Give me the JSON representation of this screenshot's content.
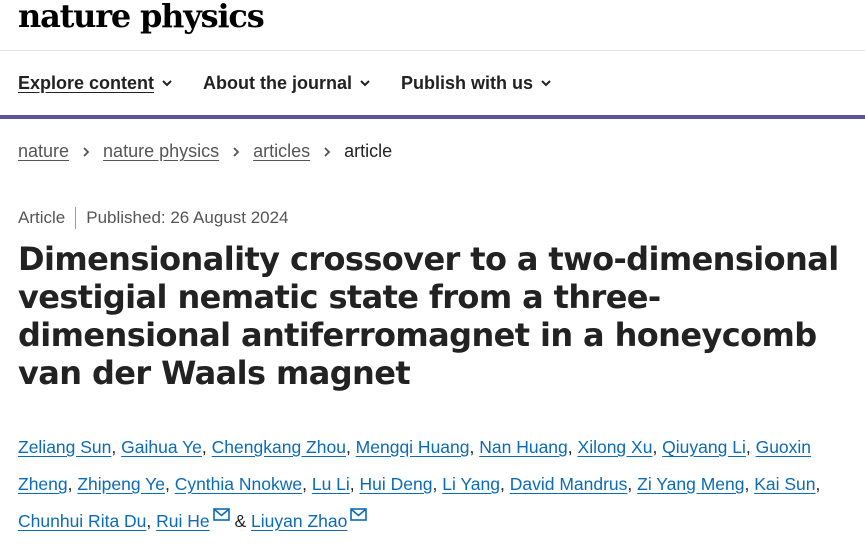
{
  "site": {
    "logo": "nature physics"
  },
  "nav": {
    "items": [
      {
        "label": "Explore content",
        "icon": "chevron-down-icon"
      },
      {
        "label": "About the journal",
        "icon": "chevron-down-icon"
      },
      {
        "label": "Publish with us",
        "icon": "chevron-down-icon"
      }
    ]
  },
  "breadcrumb": {
    "items": [
      "nature",
      "nature physics",
      "articles"
    ],
    "current": "article"
  },
  "article": {
    "type": "Article",
    "published": "Published: 26 August 2024",
    "title": "Dimensionality crossover to a two-dimensional vestigial nematic state from a three-dimensional antiferromagnet in a honeycomb van der Waals magnet",
    "authors": [
      "Zeliang Sun",
      "Gaihua Ye",
      "Chengkang Zhou",
      "Mengqi Huang",
      "Nan Huang",
      "Xilong Xu",
      "Qiuyang Li",
      "Guoxin Zheng",
      "Zhipeng Ye",
      "Cynthia Nnokwe",
      "Lu Li",
      "Hui Deng",
      "Li Yang",
      "David Mandrus",
      "Zi Yang Meng",
      "Kai Sun",
      "Chunhui Rita Du",
      "Rui He",
      "Liuyan Zhao"
    ],
    "author_separator": ", ",
    "last_separator": " & "
  },
  "colors": {
    "link": "#0b6bb8",
    "divider": "#5c559e",
    "text": "#222222",
    "muted": "#555555"
  }
}
